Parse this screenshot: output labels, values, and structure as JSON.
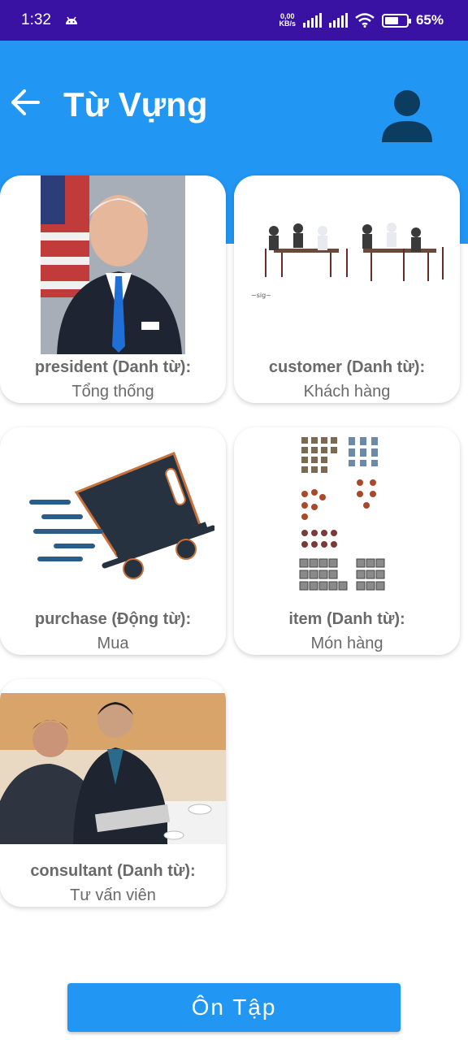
{
  "status_bar": {
    "time": "1:32",
    "net_speed_value": "0,00",
    "net_speed_unit": "KB/s",
    "battery_percent": "65%",
    "battery_level": 0.65
  },
  "app_bar": {
    "title": "Từ Vựng",
    "back_icon": "arrow-left-icon",
    "profile_icon": "user-icon"
  },
  "cards": [
    {
      "word": "president (Danh từ):",
      "meaning": "Tổng thống",
      "image": "portrait-photo"
    },
    {
      "word": "customer (Danh từ):",
      "meaning": "Khách hàng",
      "image": "people-at-tables"
    },
    {
      "word": "purchase (Động từ):",
      "meaning": "Mua",
      "image": "shopping-cart"
    },
    {
      "word": "item (Danh từ):",
      "meaning": "Món hàng",
      "image": "item-sprites"
    },
    {
      "word": "consultant (Danh từ):",
      "meaning": "Tư vấn viên",
      "image": "business-meeting-photo"
    }
  ],
  "review_button": {
    "label": "Ôn Tập"
  },
  "colors": {
    "status_bar": "#3a12a3",
    "primary": "#2196f3",
    "text_gray": "#6a6a6a"
  }
}
